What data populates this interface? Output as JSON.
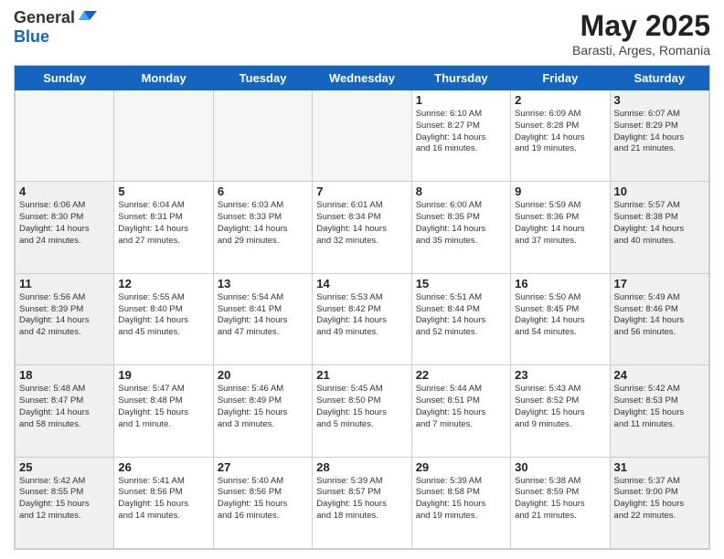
{
  "header": {
    "logo_line1": "General",
    "logo_line2": "Blue",
    "month": "May 2025",
    "location": "Barasti, Arges, Romania"
  },
  "days_of_week": [
    "Sunday",
    "Monday",
    "Tuesday",
    "Wednesday",
    "Thursday",
    "Friday",
    "Saturday"
  ],
  "weeks": [
    [
      {
        "day": "",
        "info": ""
      },
      {
        "day": "",
        "info": ""
      },
      {
        "day": "",
        "info": ""
      },
      {
        "day": "",
        "info": ""
      },
      {
        "day": "1",
        "info": "Sunrise: 6:10 AM\nSunset: 8:27 PM\nDaylight: 14 hours\nand 16 minutes."
      },
      {
        "day": "2",
        "info": "Sunrise: 6:09 AM\nSunset: 8:28 PM\nDaylight: 14 hours\nand 19 minutes."
      },
      {
        "day": "3",
        "info": "Sunrise: 6:07 AM\nSunset: 8:29 PM\nDaylight: 14 hours\nand 21 minutes."
      }
    ],
    [
      {
        "day": "4",
        "info": "Sunrise: 6:06 AM\nSunset: 8:30 PM\nDaylight: 14 hours\nand 24 minutes."
      },
      {
        "day": "5",
        "info": "Sunrise: 6:04 AM\nSunset: 8:31 PM\nDaylight: 14 hours\nand 27 minutes."
      },
      {
        "day": "6",
        "info": "Sunrise: 6:03 AM\nSunset: 8:33 PM\nDaylight: 14 hours\nand 29 minutes."
      },
      {
        "day": "7",
        "info": "Sunrise: 6:01 AM\nSunset: 8:34 PM\nDaylight: 14 hours\nand 32 minutes."
      },
      {
        "day": "8",
        "info": "Sunrise: 6:00 AM\nSunset: 8:35 PM\nDaylight: 14 hours\nand 35 minutes."
      },
      {
        "day": "9",
        "info": "Sunrise: 5:59 AM\nSunset: 8:36 PM\nDaylight: 14 hours\nand 37 minutes."
      },
      {
        "day": "10",
        "info": "Sunrise: 5:57 AM\nSunset: 8:38 PM\nDaylight: 14 hours\nand 40 minutes."
      }
    ],
    [
      {
        "day": "11",
        "info": "Sunrise: 5:56 AM\nSunset: 8:39 PM\nDaylight: 14 hours\nand 42 minutes."
      },
      {
        "day": "12",
        "info": "Sunrise: 5:55 AM\nSunset: 8:40 PM\nDaylight: 14 hours\nand 45 minutes."
      },
      {
        "day": "13",
        "info": "Sunrise: 5:54 AM\nSunset: 8:41 PM\nDaylight: 14 hours\nand 47 minutes."
      },
      {
        "day": "14",
        "info": "Sunrise: 5:53 AM\nSunset: 8:42 PM\nDaylight: 14 hours\nand 49 minutes."
      },
      {
        "day": "15",
        "info": "Sunrise: 5:51 AM\nSunset: 8:44 PM\nDaylight: 14 hours\nand 52 minutes."
      },
      {
        "day": "16",
        "info": "Sunrise: 5:50 AM\nSunset: 8:45 PM\nDaylight: 14 hours\nand 54 minutes."
      },
      {
        "day": "17",
        "info": "Sunrise: 5:49 AM\nSunset: 8:46 PM\nDaylight: 14 hours\nand 56 minutes."
      }
    ],
    [
      {
        "day": "18",
        "info": "Sunrise: 5:48 AM\nSunset: 8:47 PM\nDaylight: 14 hours\nand 58 minutes."
      },
      {
        "day": "19",
        "info": "Sunrise: 5:47 AM\nSunset: 8:48 PM\nDaylight: 15 hours\nand 1 minute."
      },
      {
        "day": "20",
        "info": "Sunrise: 5:46 AM\nSunset: 8:49 PM\nDaylight: 15 hours\nand 3 minutes."
      },
      {
        "day": "21",
        "info": "Sunrise: 5:45 AM\nSunset: 8:50 PM\nDaylight: 15 hours\nand 5 minutes."
      },
      {
        "day": "22",
        "info": "Sunrise: 5:44 AM\nSunset: 8:51 PM\nDaylight: 15 hours\nand 7 minutes."
      },
      {
        "day": "23",
        "info": "Sunrise: 5:43 AM\nSunset: 8:52 PM\nDaylight: 15 hours\nand 9 minutes."
      },
      {
        "day": "24",
        "info": "Sunrise: 5:42 AM\nSunset: 8:53 PM\nDaylight: 15 hours\nand 11 minutes."
      }
    ],
    [
      {
        "day": "25",
        "info": "Sunrise: 5:42 AM\nSunset: 8:55 PM\nDaylight: 15 hours\nand 12 minutes."
      },
      {
        "day": "26",
        "info": "Sunrise: 5:41 AM\nSunset: 8:56 PM\nDaylight: 15 hours\nand 14 minutes."
      },
      {
        "day": "27",
        "info": "Sunrise: 5:40 AM\nSunset: 8:56 PM\nDaylight: 15 hours\nand 16 minutes."
      },
      {
        "day": "28",
        "info": "Sunrise: 5:39 AM\nSunset: 8:57 PM\nDaylight: 15 hours\nand 18 minutes."
      },
      {
        "day": "29",
        "info": "Sunrise: 5:39 AM\nSunset: 8:58 PM\nDaylight: 15 hours\nand 19 minutes."
      },
      {
        "day": "30",
        "info": "Sunrise: 5:38 AM\nSunset: 8:59 PM\nDaylight: 15 hours\nand 21 minutes."
      },
      {
        "day": "31",
        "info": "Sunrise: 5:37 AM\nSunset: 9:00 PM\nDaylight: 15 hours\nand 22 minutes."
      }
    ]
  ]
}
